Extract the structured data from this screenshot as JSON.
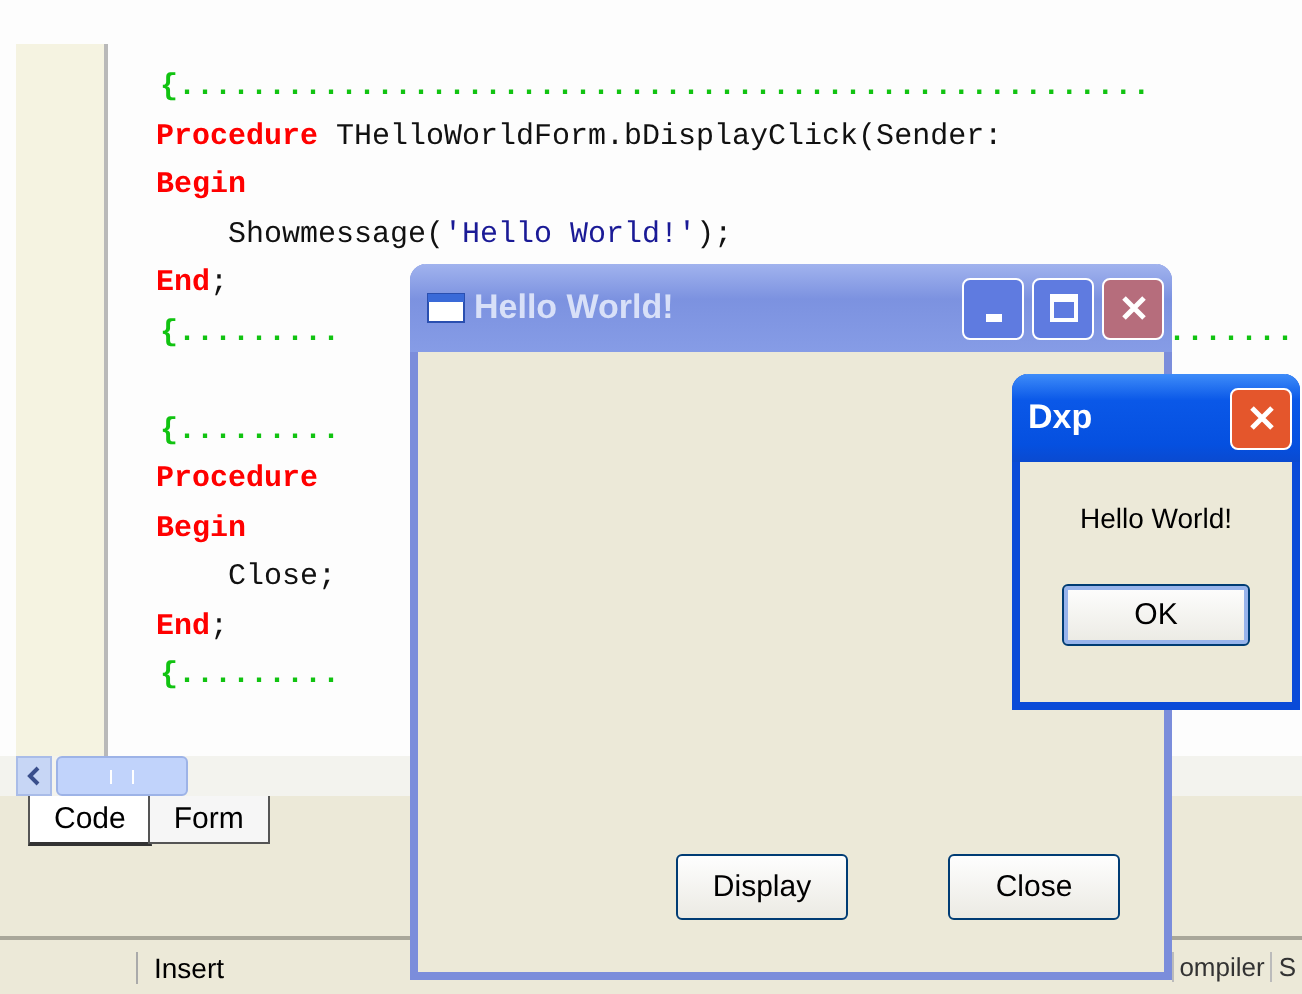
{
  "editor": {
    "lines": [
      {
        "kind": "comment",
        "text": "{......................................................"
      },
      {
        "kind": "code",
        "parts": [
          {
            "kind": "keyword",
            "text": "Procedure"
          },
          {
            "kind": "plain",
            "text": " THelloWorldForm.bDisplayClick(Sender:"
          }
        ]
      },
      {
        "kind": "code",
        "parts": [
          {
            "kind": "keyword",
            "text": "Begin"
          }
        ]
      },
      {
        "kind": "code",
        "parts": [
          {
            "kind": "plain",
            "text": "    Showmessage("
          },
          {
            "kind": "string",
            "text": "'Hello World!'"
          },
          {
            "kind": "plain",
            "text": ");"
          }
        ]
      },
      {
        "kind": "code",
        "parts": [
          {
            "kind": "keyword",
            "text": "End"
          },
          {
            "kind": "plain",
            "text": ";"
          }
        ]
      },
      {
        "kind": "comment",
        "text": "{.........",
        "tail": "......."
      },
      {
        "kind": "blank"
      },
      {
        "kind": "comment",
        "text": "{........."
      },
      {
        "kind": "code",
        "parts": [
          {
            "kind": "keyword",
            "text": "Procedure"
          }
        ]
      },
      {
        "kind": "code",
        "parts": [
          {
            "kind": "keyword",
            "text": "Begin"
          }
        ]
      },
      {
        "kind": "code",
        "parts": [
          {
            "kind": "plain",
            "text": "    Close;"
          }
        ]
      },
      {
        "kind": "code",
        "parts": [
          {
            "kind": "keyword",
            "text": "End"
          },
          {
            "kind": "plain",
            "text": ";"
          }
        ]
      },
      {
        "kind": "comment",
        "text": "{........."
      }
    ]
  },
  "tabs": [
    {
      "label": "Code",
      "selected": true
    },
    {
      "label": "Form",
      "selected": false
    }
  ],
  "status_bar": {
    "mode": "Insert",
    "panels": [
      "ompiler",
      "S"
    ]
  },
  "windows": [
    {
      "title": "Hello World!",
      "active": false,
      "buttons": [
        "Display",
        "Close"
      ]
    },
    {
      "title": "Dxp",
      "active": true,
      "message": "Hello World!",
      "buttons": [
        "OK"
      ]
    }
  ]
}
